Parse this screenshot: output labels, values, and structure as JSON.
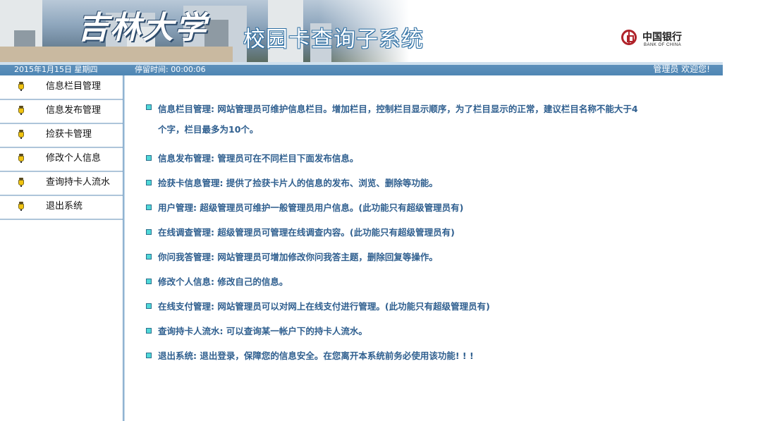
{
  "header": {
    "school_logo_text": "吉林大学",
    "system_title": "校园卡查询子系统",
    "bank_logo": {
      "cn": "中国银行",
      "en": "BANK OF CHINA"
    }
  },
  "status_bar": {
    "date": "2015年1月15日 星期四",
    "stay_time": "停留时间: 00:00:06",
    "user_greeting": "管理员   欢迎您!"
  },
  "sidebar": {
    "items": [
      {
        "label": "信息栏目管理",
        "icon": "pen-icon"
      },
      {
        "label": "信息发布管理",
        "icon": "pen-icon"
      },
      {
        "label": "捡获卡管理",
        "icon": "pen-icon"
      },
      {
        "label": "修改个人信息",
        "icon": "pen-icon"
      },
      {
        "label": "查询持卡人流水",
        "icon": "pen-icon"
      },
      {
        "label": "退出系统",
        "icon": "pen-icon"
      }
    ]
  },
  "content": {
    "items": [
      {
        "text": "信息栏目管理: 网站管理员可维护信息栏目。增加栏目，控制栏目显示顺序，为了栏目显示的正常，建议栏目名称不能大于4",
        "text2": "个字，栏目最多为10个。"
      },
      {
        "text": "信息发布管理: 管理员可在不同栏目下面发布信息。"
      },
      {
        "text": "捡获卡信息管理: 提供了捡获卡片人的信息的发布、浏览、删除等功能。"
      },
      {
        "text": "用户管理: 超级管理员可维护一般管理员用户信息。(此功能只有超级管理员有)"
      },
      {
        "text": "在线调查管理: 超级管理员可管理在线调查内容。(此功能只有超级管理员有)"
      },
      {
        "text": "你问我答管理: 网站管理员可增加修改你问我答主题，删除回复等操作。"
      },
      {
        "text": "修改个人信息: 修改自己的信息。"
      },
      {
        "text": "在线支付管理: 网站管理员可以对网上在线支付进行管理。(此功能只有超级管理员有)"
      },
      {
        "text": "查询持卡人流水: 可以查询某一帐户下的持卡人流水。"
      },
      {
        "text": "退出系统: 退出登录，保障您的信息安全。在您离开本系统前务必使用该功能! ! !"
      }
    ]
  },
  "colors": {
    "status_bar": "#4f86b4",
    "content_text": "#2f5f8f",
    "bullet": "#4fd8d8",
    "sidebar_border": "#aec5da"
  }
}
